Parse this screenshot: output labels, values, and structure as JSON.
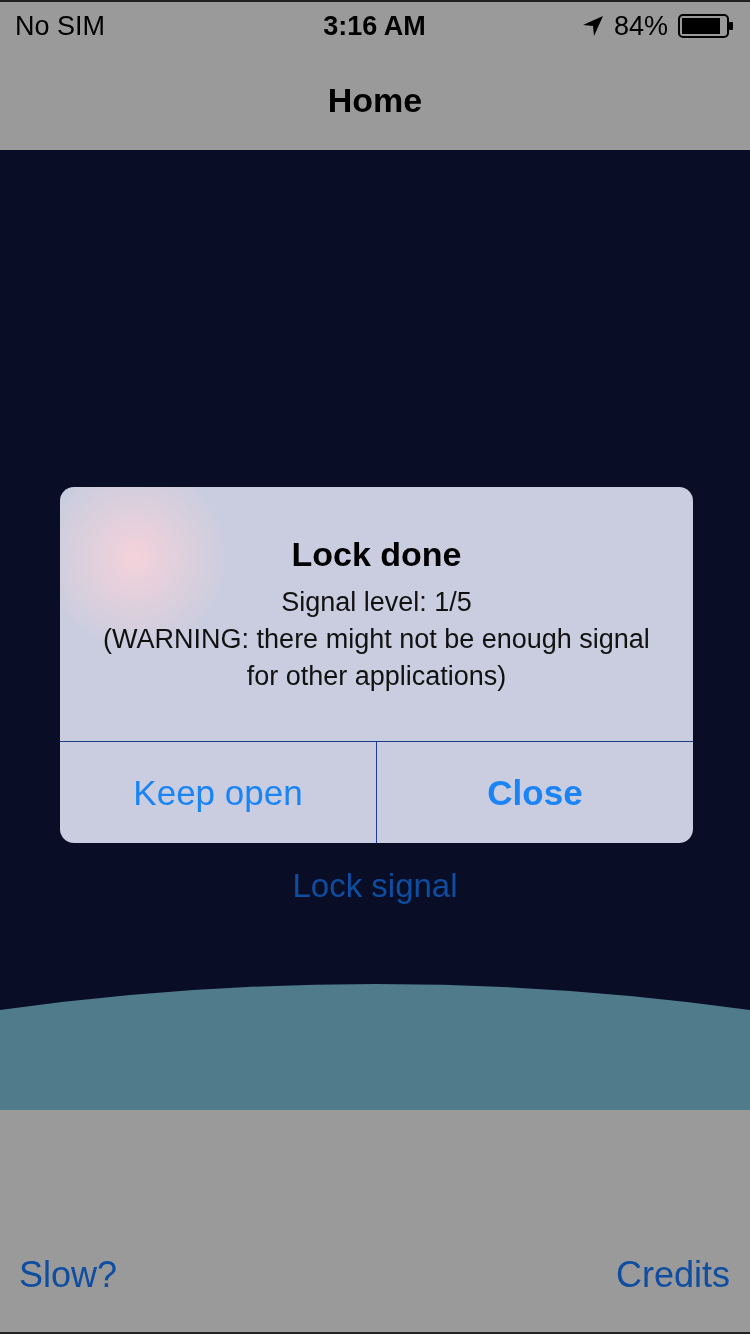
{
  "status_bar": {
    "carrier": "No SIM",
    "time": "3:16 AM",
    "battery": "84%"
  },
  "nav_bar": {
    "title": "Home"
  },
  "main": {
    "action_link": "Lock signal"
  },
  "alert": {
    "title": "Lock done",
    "message_lines": [
      "Signal level: 1/5",
      "(WARNING: there might not be enough signal for other applications)"
    ],
    "buttons": [
      {
        "label": "Keep open",
        "kind": "normal"
      },
      {
        "label": "Close",
        "kind": "preferred"
      }
    ]
  },
  "bottom_bar": {
    "links": [
      "Slow?",
      "Credits"
    ]
  }
}
